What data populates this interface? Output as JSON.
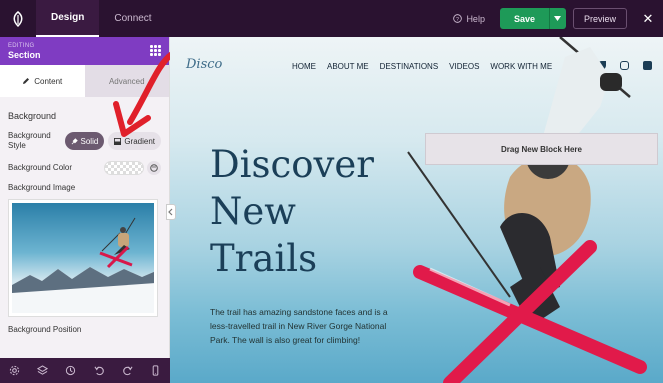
{
  "topbar": {
    "tabs": [
      {
        "label": "Design"
      },
      {
        "label": "Connect"
      }
    ],
    "help_label": "Help",
    "save_label": "Save",
    "preview_label": "Preview"
  },
  "sidebar": {
    "editing_label": "EDITING",
    "section_label": "Section",
    "tabs": [
      {
        "label": "Content"
      },
      {
        "label": "Advanced"
      }
    ],
    "background_title": "Background",
    "background_style_label": "Background Style",
    "style_options": [
      {
        "label": "Solid"
      },
      {
        "label": "Gradient"
      }
    ],
    "background_color_label": "Background Color",
    "background_image_label": "Background Image",
    "background_position_label": "Background Position"
  },
  "canvas": {
    "brand": "Disco",
    "nav": [
      "HOME",
      "ABOUT ME",
      "DESTINATIONS",
      "VIDEOS",
      "WORK WITH ME"
    ],
    "drag_label": "Drag New Block Here",
    "hero_lines": [
      "Discover",
      "New",
      "Trails"
    ],
    "paragraph": "The trail has amazing sandstone faces and is a less-travelled trail in New River Gorge National Park. The wall is also great for climbing!"
  },
  "colors": {
    "accent": "#7f3cc2",
    "topbar": "#2a1230",
    "save": "#1e9a58",
    "arrow": "#e0202a"
  }
}
